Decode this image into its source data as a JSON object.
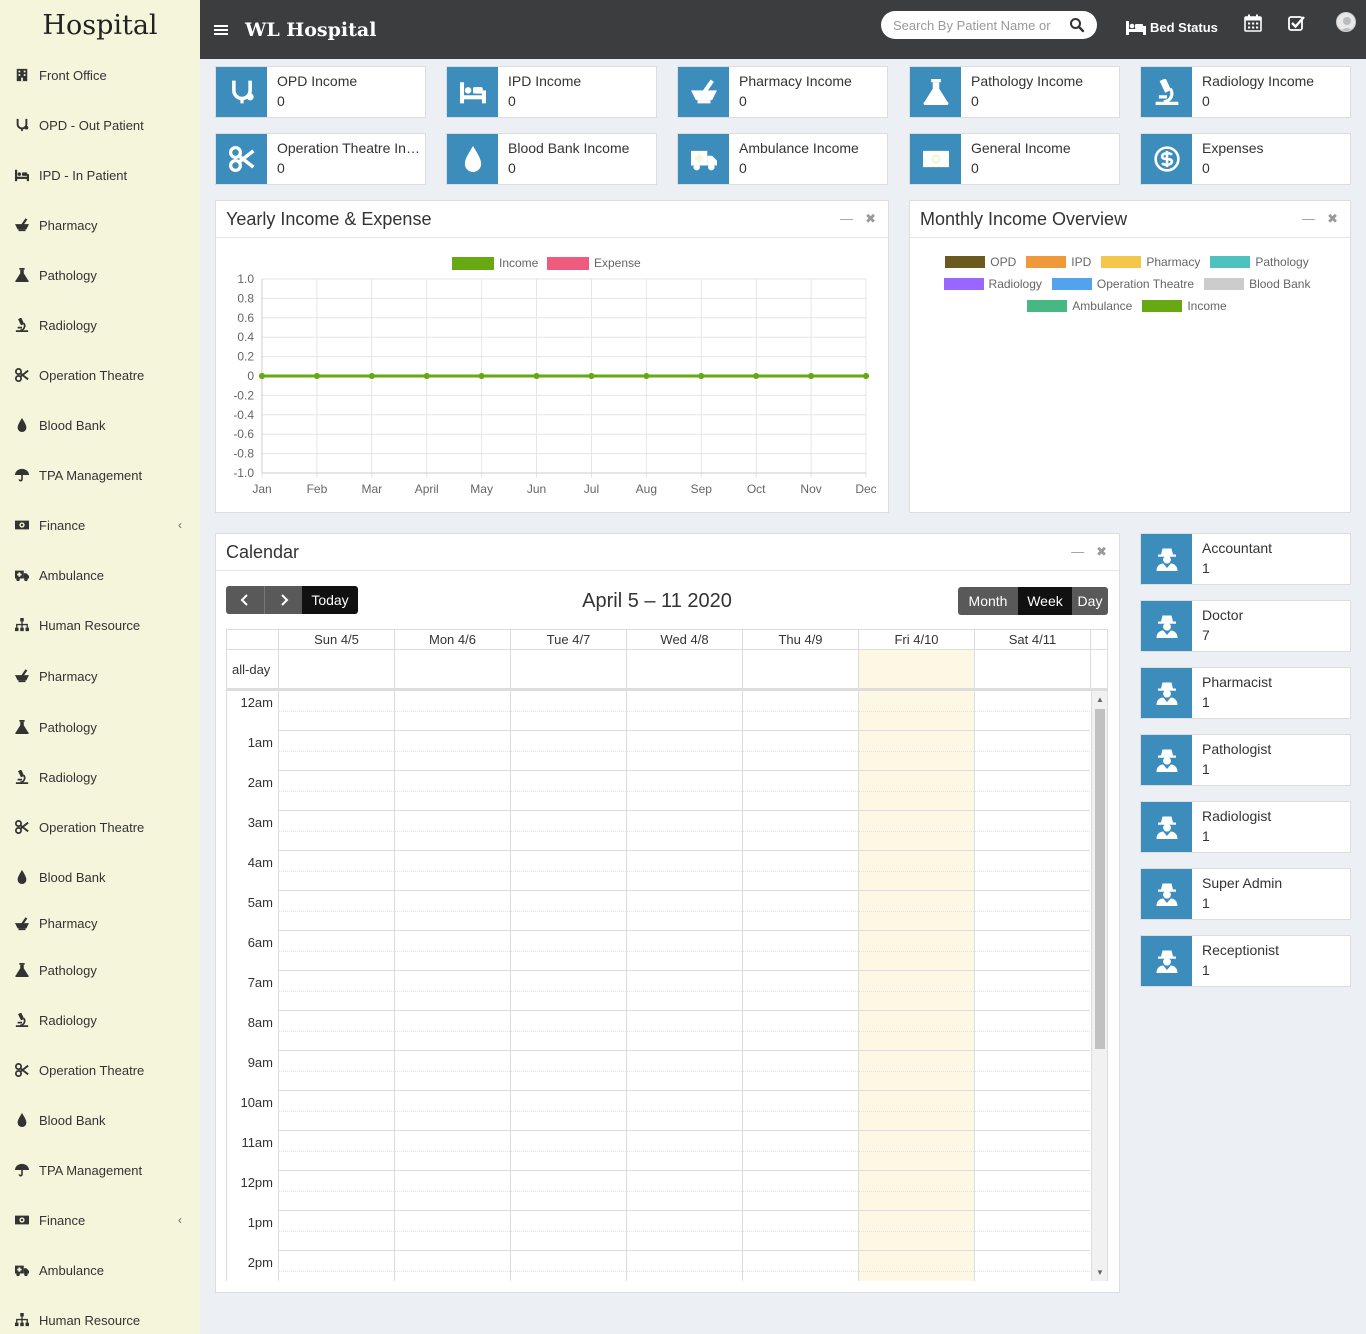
{
  "sidebar": {
    "brand": "Hospital",
    "items": [
      {
        "label": "Front Office",
        "icon": "building-icon",
        "chevron": false
      },
      {
        "label": "OPD - Out Patient",
        "icon": "stethoscope-icon",
        "chevron": false
      },
      {
        "label": "IPD - In Patient",
        "icon": "bed-icon",
        "chevron": false
      },
      {
        "label": "Pharmacy",
        "icon": "mortar-pestle-icon",
        "chevron": false
      },
      {
        "label": "Pathology",
        "icon": "flask-icon",
        "chevron": false
      },
      {
        "label": "Radiology",
        "icon": "microscope-icon",
        "chevron": false
      },
      {
        "label": "Operation Theatre",
        "icon": "scissors-icon",
        "chevron": false
      },
      {
        "label": "Blood Bank",
        "icon": "tint-icon",
        "chevron": false
      },
      {
        "label": "TPA Management",
        "icon": "umbrella-icon",
        "chevron": false
      },
      {
        "label": "Finance",
        "icon": "money-icon",
        "chevron": true
      },
      {
        "label": "Ambulance",
        "icon": "ambulance-icon",
        "chevron": false
      },
      {
        "label": "Human Resource",
        "icon": "sitemap-icon",
        "chevron": false
      },
      {
        "label": "Pharmacy",
        "icon": "mortar-pestle-icon",
        "chevron": false
      },
      {
        "label": "Pathology",
        "icon": "flask-icon",
        "chevron": false
      },
      {
        "label": "Radiology",
        "icon": "microscope-icon",
        "chevron": false
      },
      {
        "label": "Operation Theatre",
        "icon": "scissors-icon",
        "chevron": false
      },
      {
        "label": "Blood Bank",
        "icon": "tint-icon",
        "chevron": false
      },
      {
        "label": "Pharmacy",
        "icon": "mortar-pestle-icon",
        "chevron": false
      },
      {
        "label": "Pathology",
        "icon": "flask-icon",
        "chevron": false
      },
      {
        "label": "Radiology",
        "icon": "microscope-icon",
        "chevron": false
      },
      {
        "label": "Operation Theatre",
        "icon": "scissors-icon",
        "chevron": false
      },
      {
        "label": "Blood Bank",
        "icon": "tint-icon",
        "chevron": false
      },
      {
        "label": "TPA Management",
        "icon": "umbrella-icon",
        "chevron": false
      },
      {
        "label": "Finance",
        "icon": "money-icon",
        "chevron": true
      },
      {
        "label": "Ambulance",
        "icon": "ambulance-icon",
        "chevron": false
      },
      {
        "label": "Human Resource",
        "icon": "sitemap-icon",
        "chevron": false
      }
    ]
  },
  "header": {
    "title": "WL Hospital",
    "search_placeholder": "Search By Patient Name or",
    "bed_status": "Bed Status"
  },
  "income_boxes": [
    {
      "label": "OPD Income",
      "value": "0",
      "icon": "stethoscope-icon"
    },
    {
      "label": "IPD Income",
      "value": "0",
      "icon": "bed-icon"
    },
    {
      "label": "Pharmacy Income",
      "value": "0",
      "icon": "mortar-pestle-icon"
    },
    {
      "label": "Pathology Income",
      "value": "0",
      "icon": "flask-icon"
    },
    {
      "label": "Radiology Income",
      "value": "0",
      "icon": "microscope-icon"
    },
    {
      "label": "Operation Theatre Income",
      "value": "0",
      "icon": "scissors-icon"
    },
    {
      "label": "Blood Bank Income",
      "value": "0",
      "icon": "tint-icon"
    },
    {
      "label": "Ambulance Income",
      "value": "0",
      "icon": "ambulance-icon"
    },
    {
      "label": "General Income",
      "value": "0",
      "icon": "money-icon"
    },
    {
      "label": "Expenses",
      "value": "0",
      "icon": "expense-icon"
    }
  ],
  "yearly_panel": {
    "title": "Yearly Income & Expense"
  },
  "monthly_panel": {
    "title": "Monthly Income Overview",
    "legend": [
      {
        "name": "OPD",
        "color": "#6b5a1d"
      },
      {
        "name": "IPD",
        "color": "#f0993a"
      },
      {
        "name": "Pharmacy",
        "color": "#f4c64c"
      },
      {
        "name": "Pathology",
        "color": "#4ec2bf"
      },
      {
        "name": "Radiology",
        "color": "#9966ff"
      },
      {
        "name": "Operation Theatre",
        "color": "#52a3eb"
      },
      {
        "name": "Blood Bank",
        "color": "#cccccc"
      },
      {
        "name": "Ambulance",
        "color": "#48b882"
      },
      {
        "name": "Income",
        "color": "#66a913"
      }
    ]
  },
  "chart_data": {
    "type": "line",
    "title": "",
    "xlabel": "",
    "ylabel": "",
    "categories": [
      "Jan",
      "Feb",
      "Mar",
      "April",
      "May",
      "Jun",
      "Jul",
      "Aug",
      "Sep",
      "Oct",
      "Nov",
      "Dec"
    ],
    "series": [
      {
        "name": "Income",
        "color": "#66a913",
        "values": [
          0,
          0,
          0,
          0,
          0,
          0,
          0,
          0,
          0,
          0,
          0,
          0
        ]
      },
      {
        "name": "Expense",
        "color": "#ef5b7c",
        "values": [
          0,
          0,
          0,
          0,
          0,
          0,
          0,
          0,
          0,
          0,
          0,
          0
        ]
      }
    ],
    "ylim": [
      -1.0,
      1.0
    ],
    "yticks": [
      "1.0",
      "0.8",
      "0.6",
      "0.4",
      "0.2",
      "0",
      "-0.2",
      "-0.4",
      "-0.6",
      "-0.8",
      "-1.0"
    ],
    "grid": true,
    "legend": "top"
  },
  "calendar": {
    "title": "Calendar",
    "range": "April 5 – 11 2020",
    "today_label": "Today",
    "views": [
      "Month",
      "Week",
      "Day"
    ],
    "active_view": "Week",
    "all_day": "all-day",
    "days": [
      "Sun 4/5",
      "Mon 4/6",
      "Tue 4/7",
      "Wed 4/8",
      "Thu 4/9",
      "Fri 4/10",
      "Sat 4/11"
    ],
    "today_index": 5,
    "times": [
      "12am",
      "1am",
      "2am",
      "3am",
      "4am",
      "5am",
      "6am",
      "7am",
      "8am",
      "9am",
      "10am",
      "11am",
      "12pm",
      "1pm",
      "2pm"
    ]
  },
  "users": [
    {
      "label": "Accountant",
      "value": "1"
    },
    {
      "label": "Doctor",
      "value": "7"
    },
    {
      "label": "Pharmacist",
      "value": "1"
    },
    {
      "label": "Pathologist",
      "value": "1"
    },
    {
      "label": "Radiologist",
      "value": "1"
    },
    {
      "label": "Super Admin",
      "value": "1"
    },
    {
      "label": "Receptionist",
      "value": "1"
    }
  ]
}
